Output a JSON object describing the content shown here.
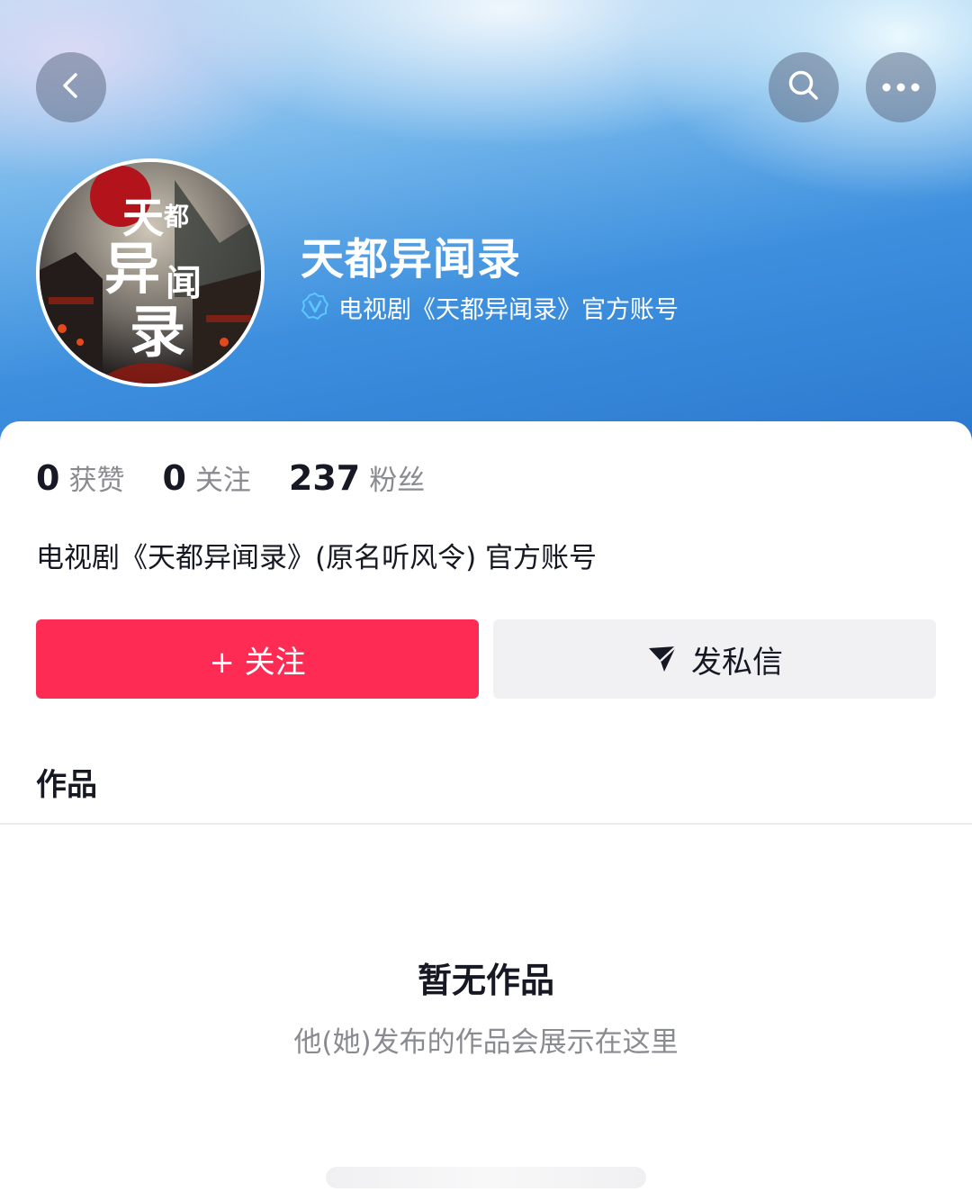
{
  "header": {
    "back_icon": "chevron-left-icon",
    "search_icon": "search-icon",
    "more_icon": "more-horizontal-icon"
  },
  "profile": {
    "name": "天都异闻录",
    "verification_icon": "verified-badge-icon",
    "verification_text": "电视剧《天都异闻录》官方账号",
    "avatar_lettering": "天都异闻录"
  },
  "stats": [
    {
      "value": "0",
      "label": "获赞"
    },
    {
      "value": "0",
      "label": "关注"
    },
    {
      "value": "237",
      "label": "粉丝"
    }
  ],
  "bio": "电视剧《天都异闻录》(原名听风令) 官方账号",
  "actions": {
    "follow_label": "+ 关注",
    "message_label": "发私信",
    "message_icon": "send-icon"
  },
  "tabs": {
    "works_label": "作品"
  },
  "empty_state": {
    "title": "暂无作品",
    "subtitle": "他(她)发布的作品会展示在这里"
  },
  "colors": {
    "accent": "#fe2c55",
    "header_blue": "#3d8fde"
  }
}
